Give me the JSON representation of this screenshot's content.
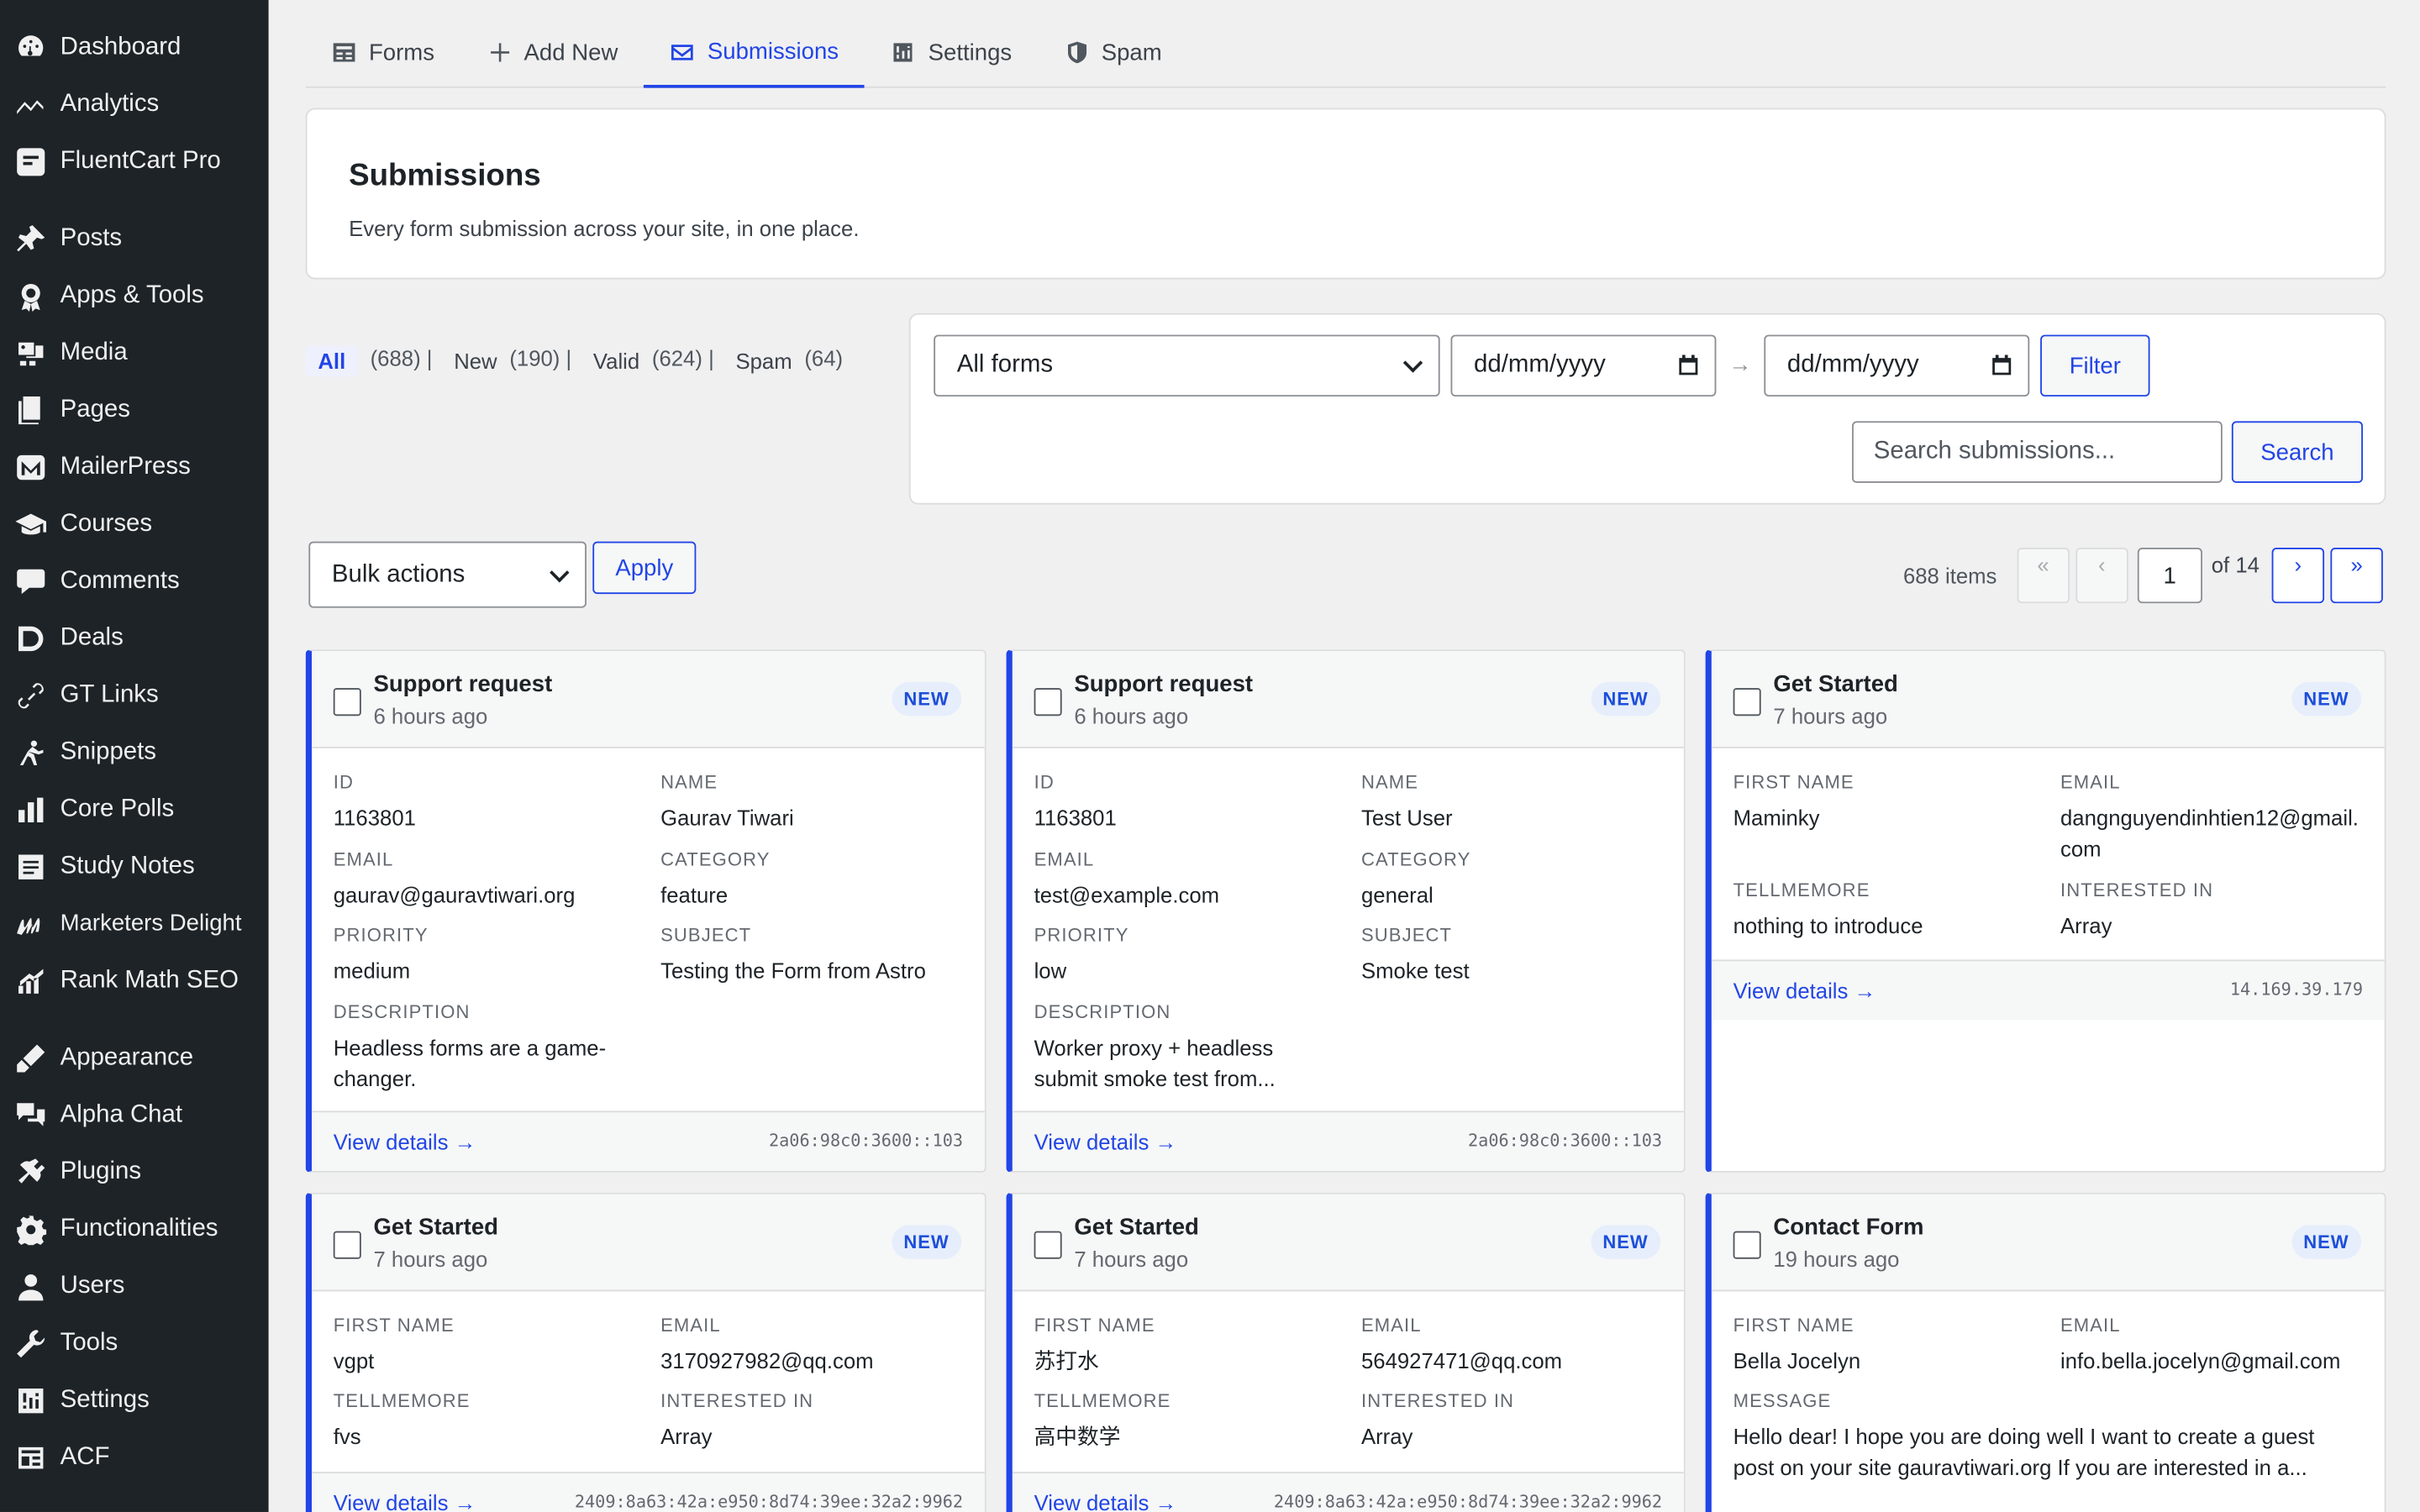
{
  "sidebar": {
    "items": [
      {
        "label": "Dashboard",
        "icon": "dashboard-icon"
      },
      {
        "label": "Analytics",
        "icon": "analytics-icon"
      },
      {
        "label": "FluentCart Pro",
        "icon": "fluentcart-icon"
      },
      {
        "label": "Posts",
        "icon": "pin-icon"
      },
      {
        "label": "Apps & Tools",
        "icon": "apps-icon"
      },
      {
        "label": "Media",
        "icon": "media-icon"
      },
      {
        "label": "Pages",
        "icon": "pages-icon"
      },
      {
        "label": "MailerPress",
        "icon": "mailerpress-icon"
      },
      {
        "label": "Courses",
        "icon": "courses-icon"
      },
      {
        "label": "Comments",
        "icon": "comments-icon"
      },
      {
        "label": "Deals",
        "icon": "deals-icon"
      },
      {
        "label": "GT Links",
        "icon": "link-icon"
      },
      {
        "label": "Snippets",
        "icon": "snippets-icon"
      },
      {
        "label": "Core Polls",
        "icon": "polls-icon"
      },
      {
        "label": "Study Notes",
        "icon": "notes-icon"
      },
      {
        "label": "Marketers Delight",
        "icon": "md-icon"
      },
      {
        "label": "Rank Math SEO",
        "icon": "rankmath-icon"
      },
      {
        "label": "Appearance",
        "icon": "appearance-icon"
      },
      {
        "label": "Alpha Chat",
        "icon": "chat-icon"
      },
      {
        "label": "Plugins",
        "icon": "plugins-icon"
      },
      {
        "label": "Functionalities",
        "icon": "gear-icon"
      },
      {
        "label": "Users",
        "icon": "users-icon"
      },
      {
        "label": "Tools",
        "icon": "tools-icon"
      },
      {
        "label": "Settings",
        "icon": "settings-icon"
      },
      {
        "label": "ACF",
        "icon": "acf-icon"
      }
    ]
  },
  "tabs": [
    {
      "label": "Forms",
      "icon": "forms-icon"
    },
    {
      "label": "Add New",
      "icon": "plus-icon"
    },
    {
      "label": "Submissions",
      "icon": "envelope-icon",
      "active": true
    },
    {
      "label": "Settings",
      "icon": "settings-icon"
    },
    {
      "label": "Spam",
      "icon": "shield-icon"
    }
  ],
  "header": {
    "title": "Submissions",
    "subtitle": "Every form submission across your site, in one place."
  },
  "views": [
    {
      "label": "All",
      "count": "(688) |"
    },
    {
      "label": "New",
      "count": "(190) |"
    },
    {
      "label": "Valid",
      "count": "(624) |"
    },
    {
      "label": "Spam",
      "count": "(64)"
    }
  ],
  "filters": {
    "form_select": "All forms",
    "date_from": "dd/mm/yyyy",
    "date_sep": "→",
    "date_to": "dd/mm/yyyy",
    "filter_label": "Filter",
    "search_placeholder": "Search submissions...",
    "search_label": "Search"
  },
  "bulk": {
    "select": "Bulk actions",
    "apply": "Apply"
  },
  "pager": {
    "items": "688 items",
    "first": "«",
    "prev": "‹",
    "current": "1",
    "of": "of 14",
    "next": "›",
    "last": "»"
  },
  "cards": [
    {
      "title": "Support request",
      "time": "6 hours ago",
      "badge": "NEW",
      "fields": [
        {
          "k": "ID",
          "v": "1163801"
        },
        {
          "k": "NAME",
          "v": "Gaurav Tiwari"
        },
        {
          "k": "EMAIL",
          "v": "gaurav@gauravtiwari.org"
        },
        {
          "k": "CATEGORY",
          "v": "feature"
        },
        {
          "k": "PRIORITY",
          "v": "medium"
        },
        {
          "k": "SUBJECT",
          "v": "Testing the Form from Astro"
        },
        {
          "k": "DESCRIPTION",
          "v": "Headless forms are a game-changer."
        }
      ],
      "view": "View details →",
      "ip": "2a06:98c0:3600::103"
    },
    {
      "title": "Support request",
      "time": "6 hours ago",
      "badge": "NEW",
      "fields": [
        {
          "k": "ID",
          "v": "1163801"
        },
        {
          "k": "NAME",
          "v": "Test User"
        },
        {
          "k": "EMAIL",
          "v": "test@example.com"
        },
        {
          "k": "CATEGORY",
          "v": "general"
        },
        {
          "k": "PRIORITY",
          "v": "low"
        },
        {
          "k": "SUBJECT",
          "v": "Smoke test"
        },
        {
          "k": "DESCRIPTION",
          "v": "Worker proxy + headless submit smoke test from..."
        }
      ],
      "view": "View details →",
      "ip": "2a06:98c0:3600::103"
    },
    {
      "title": "Get Started",
      "time": "7 hours ago",
      "badge": "NEW",
      "fields": [
        {
          "k": "FIRST NAME",
          "v": "Maminky"
        },
        {
          "k": "EMAIL",
          "v": "dangnguyendinhtien12@gmail.com"
        },
        {
          "k": "TELLMEMORE",
          "v": "nothing to introduce"
        },
        {
          "k": "INTERESTED IN",
          "v": "Array"
        }
      ],
      "view": "View details →",
      "ip": "14.169.39.179"
    },
    {
      "title": "Get Started",
      "time": "7 hours ago",
      "badge": "NEW",
      "fields": [
        {
          "k": "FIRST NAME",
          "v": "vgpt"
        },
        {
          "k": "EMAIL",
          "v": "3170927982@qq.com"
        },
        {
          "k": "TELLMEMORE",
          "v": "fvs"
        },
        {
          "k": "INTERESTED IN",
          "v": "Array"
        }
      ],
      "view": "View details →",
      "ip": "2409:8a63:42a:e950:8d74:39ee:32a2:9962"
    },
    {
      "title": "Get Started",
      "time": "7 hours ago",
      "badge": "NEW",
      "fields": [
        {
          "k": "FIRST NAME",
          "v": "苏打水"
        },
        {
          "k": "EMAIL",
          "v": "564927471@qq.com"
        },
        {
          "k": "TELLMEMORE",
          "v": "高中数学"
        },
        {
          "k": "INTERESTED IN",
          "v": "Array"
        }
      ],
      "view": "View details →",
      "ip": "2409:8a63:42a:e950:8d74:39ee:32a2:9962"
    },
    {
      "title": "Contact Form",
      "time": "19 hours ago",
      "badge": "NEW",
      "fields": [
        {
          "k": "FIRST NAME",
          "v": "Bella Jocelyn"
        },
        {
          "k": "EMAIL",
          "v": "info.bella.jocelyn@gmail.com"
        },
        {
          "k": "MESSAGE",
          "v": "Hello dear! I hope you are doing well I want to create a guest post on your site gauravtiwari.org If you are interested in a..."
        }
      ],
      "view": "",
      "ip": ""
    }
  ],
  "colors": {
    "accent": "#2145e6",
    "sidebar_bg": "#1d2327",
    "badge_bg": "#e6eefc"
  }
}
